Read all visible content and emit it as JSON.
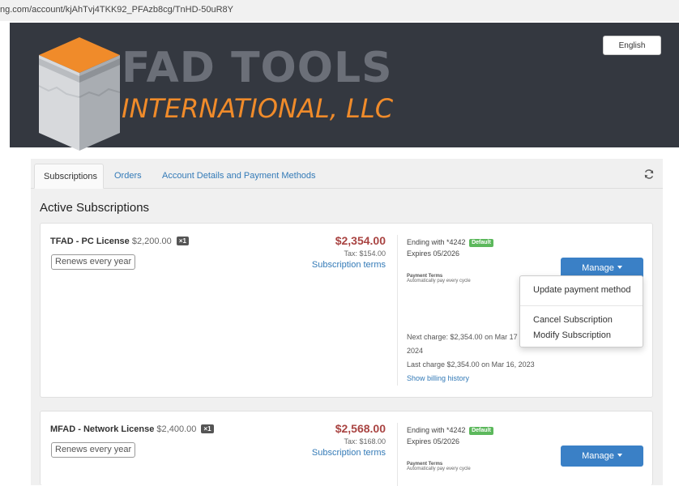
{
  "browser": {
    "url": "ng.com/account/kjAhTvj4TKK92_PFAzb8cg/TnHD-50uR8Y"
  },
  "header": {
    "language_button": "English",
    "logo_line1": "FAD TOOLS",
    "logo_line2": "INTERNATIONAL, LLC",
    "colors": {
      "background": "#343840",
      "logo_gray": "#6b6f78",
      "logo_orange": "#f08b2a"
    }
  },
  "tabs": [
    {
      "label": "Subscriptions",
      "active": true
    },
    {
      "label": "Orders",
      "active": false
    },
    {
      "label": "Account Details and Payment Methods",
      "active": false
    }
  ],
  "icons": {
    "refresh": "refresh-icon",
    "caret": "caret-down-icon"
  },
  "section_title": "Active Subscriptions",
  "subscriptions": [
    {
      "product": "TFAD - PC License",
      "base_price": "$2,200.00",
      "quantity": "×1",
      "renewal": "Renews every year",
      "total": "$2,354.00",
      "tax": "Tax: $154.00",
      "terms_link": "Subscription terms",
      "card_ending": "Ending with *4242",
      "default_badge": "Default",
      "expires": "Expires 05/2026",
      "payment_terms_label": "Payment Terms",
      "payment_terms_value": "Automatically pay every cycle",
      "manage_label": "Manage",
      "next_charge_line1": "Next charge: $2,354.00 on Mar 17",
      "next_charge_line2": "2024",
      "last_charge": "Last charge $2,354.00 on Mar 16, 2023",
      "billing_history": "Show billing history"
    },
    {
      "product": "MFAD - Network License",
      "base_price": "$2,400.00",
      "quantity": "×1",
      "renewal": "Renews every year",
      "total": "$2,568.00",
      "tax": "Tax: $168.00",
      "terms_link": "Subscription terms",
      "card_ending": "Ending with *4242",
      "default_badge": "Default",
      "expires": "Expires 05/2026",
      "payment_terms_label": "Payment Terms",
      "payment_terms_value": "Automatically pay every cycle",
      "manage_label": "Manage"
    }
  ],
  "manage_menu": {
    "items": [
      "Update payment method",
      "Cancel Subscription",
      "Modify Subscription"
    ]
  }
}
